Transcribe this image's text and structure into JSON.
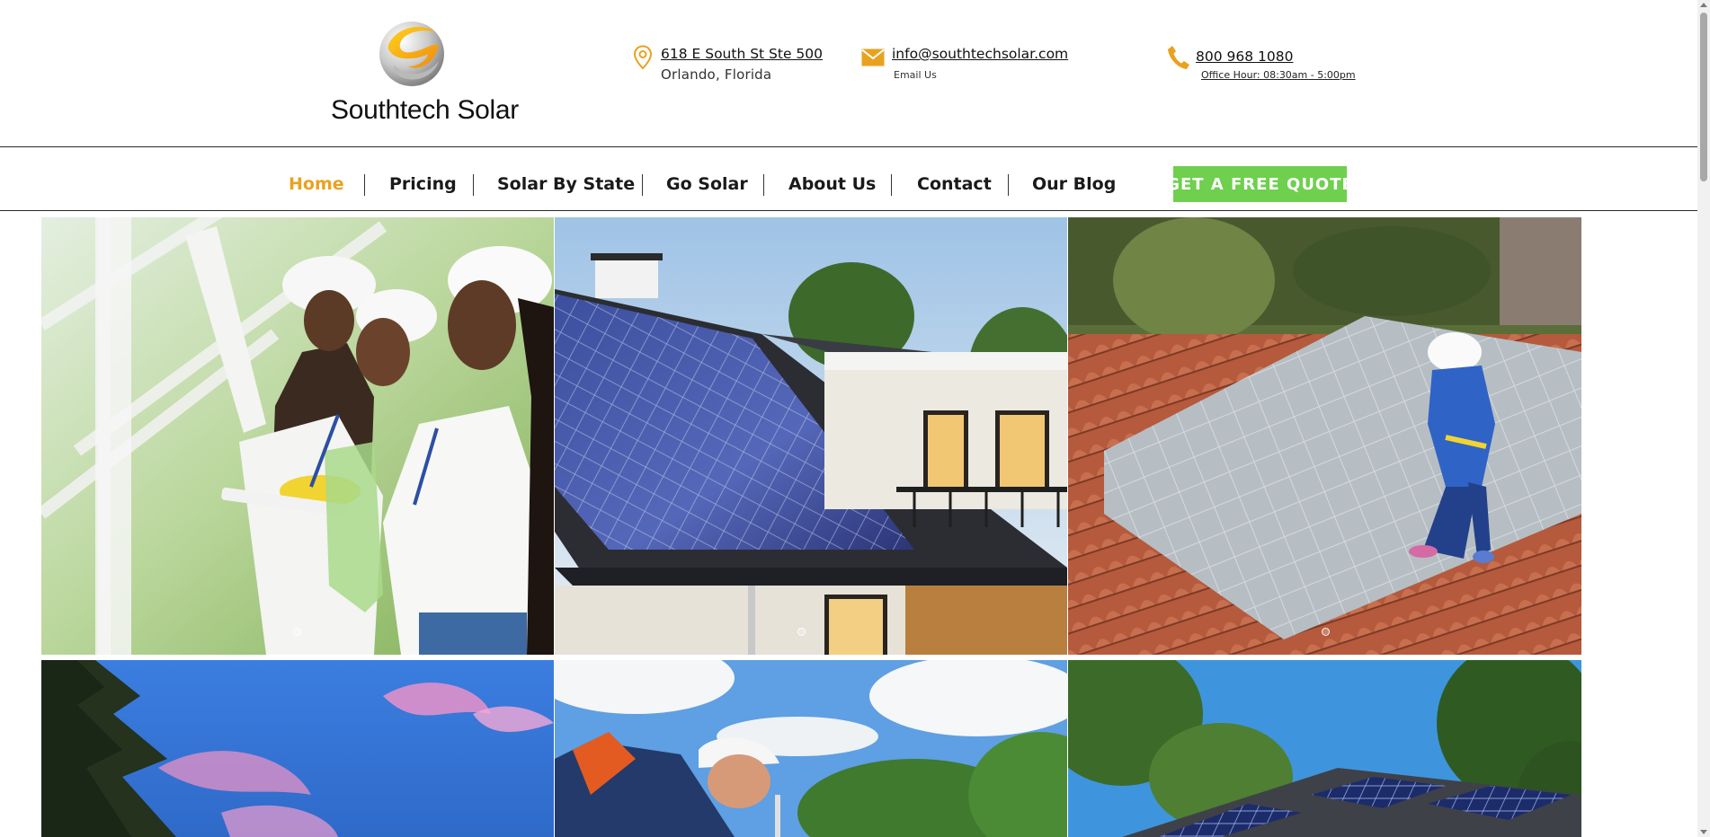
{
  "brand": {
    "name": "Southtech Solar"
  },
  "contact": {
    "address_line1": "618 E South St Ste 500",
    "address_line2": "Orlando, Florida",
    "email": "info@southtechsolar.com",
    "email_label": "Email Us",
    "phone": "800 968 1080",
    "hours": "Office Hour: 08:30am - 5:00pm"
  },
  "nav": {
    "items": [
      {
        "label": "Home",
        "active": true
      },
      {
        "label": "Pricing"
      },
      {
        "label": "Solar By State"
      },
      {
        "label": "Go Solar"
      },
      {
        "label": "About Us"
      },
      {
        "label": "Contact"
      },
      {
        "label": "Our Blog"
      }
    ],
    "cta": "GET A FREE QUOTE"
  },
  "colors": {
    "accent_orange": "#e9a21f",
    "cta_green": "#6fcf4e",
    "text_dark": "#1a1a1a",
    "divider": "#2a2a2a"
  },
  "gallery": {
    "tiles": [
      {
        "image": "solar technicians in white hard hats inspecting panel frame"
      },
      {
        "image": "modern house with blue solar panels on dark roof"
      },
      {
        "image": "woman technician in blue overalls on tiled roof with solar panels"
      },
      {
        "image": "evergreen tree against pink and blue sky"
      },
      {
        "image": "installer in white hard hat with cloudy sky"
      },
      {
        "image": "house roof with solar panels among green trees"
      }
    ]
  }
}
